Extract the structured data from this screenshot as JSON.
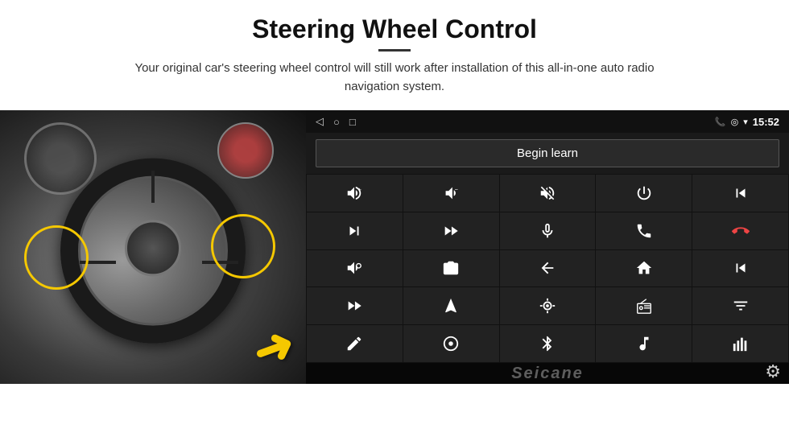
{
  "header": {
    "title": "Steering Wheel Control",
    "subtitle": "Your original car's steering wheel control will still work after installation of this all-in-one auto radio navigation system."
  },
  "status_bar": {
    "time": "15:52",
    "nav_icons": [
      "◁",
      "○",
      "□"
    ]
  },
  "begin_learn_btn": "Begin learn",
  "watermark": "Seicane",
  "control_buttons": [
    {
      "icon": "vol_up",
      "unicode": "🔊+"
    },
    {
      "icon": "vol_down",
      "unicode": "🔉−"
    },
    {
      "icon": "mute",
      "unicode": "🔇"
    },
    {
      "icon": "power",
      "unicode": "⏻"
    },
    {
      "icon": "prev_track",
      "unicode": "⏮"
    },
    {
      "icon": "next_track",
      "unicode": "⏭"
    },
    {
      "icon": "ff_skip",
      "unicode": "⏩"
    },
    {
      "icon": "mic",
      "unicode": "🎤"
    },
    {
      "icon": "call",
      "unicode": "📞"
    },
    {
      "icon": "hang_up",
      "unicode": "↩"
    },
    {
      "icon": "horn",
      "unicode": "📣"
    },
    {
      "icon": "360_cam",
      "unicode": "360"
    },
    {
      "icon": "back",
      "unicode": "↩"
    },
    {
      "icon": "home",
      "unicode": "⌂"
    },
    {
      "icon": "skip_back",
      "unicode": "⏮"
    },
    {
      "icon": "ff2",
      "unicode": "⏭"
    },
    {
      "icon": "nav",
      "unicode": "▲"
    },
    {
      "icon": "source",
      "unicode": "⏺"
    },
    {
      "icon": "radio",
      "unicode": "📻"
    },
    {
      "icon": "equalizer",
      "unicode": "⚡"
    },
    {
      "icon": "pen",
      "unicode": "✏"
    },
    {
      "icon": "settings2",
      "unicode": "⚙"
    },
    {
      "icon": "bluetooth",
      "unicode": "⚡"
    },
    {
      "icon": "music",
      "unicode": "♪"
    },
    {
      "icon": "bars",
      "unicode": "📊"
    }
  ]
}
